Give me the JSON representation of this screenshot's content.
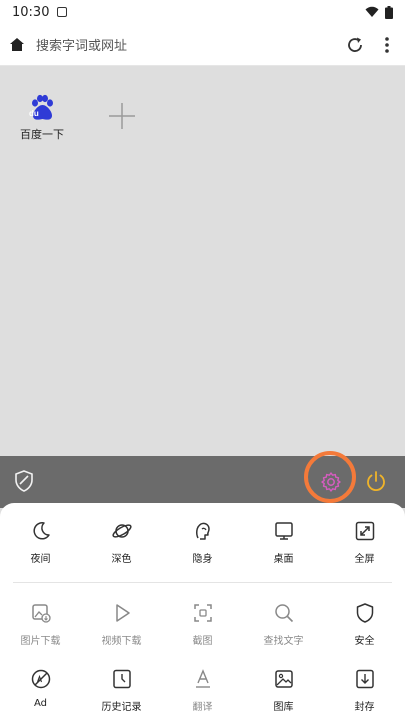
{
  "status": {
    "time": "10:30"
  },
  "toolbar": {
    "search_placeholder": "搜索字词或网址"
  },
  "shortcuts": [
    {
      "label": "百度一下",
      "logo_text": "du"
    }
  ],
  "menu": {
    "row1": [
      {
        "label": "夜间",
        "icon": "moon-icon"
      },
      {
        "label": "深色",
        "icon": "planet-icon"
      },
      {
        "label": "隐身",
        "icon": "incognito-icon"
      },
      {
        "label": "桌面",
        "icon": "desktop-icon"
      },
      {
        "label": "全屏",
        "icon": "fullscreen-icon"
      }
    ],
    "row2": [
      {
        "label": "图片下载",
        "icon": "image-download-icon"
      },
      {
        "label": "视频下载",
        "icon": "video-play-icon"
      },
      {
        "label": "截图",
        "icon": "screenshot-icon"
      },
      {
        "label": "查找文字",
        "icon": "search-icon"
      },
      {
        "label": "安全",
        "icon": "shield-icon"
      }
    ],
    "row3": [
      {
        "label": "Ad",
        "icon": "ad-block-icon"
      },
      {
        "label": "历史记录",
        "icon": "history-icon"
      },
      {
        "label": "翻译",
        "icon": "translate-icon"
      },
      {
        "label": "图库",
        "icon": "gallery-icon"
      },
      {
        "label": "封存",
        "icon": "archive-download-icon"
      }
    ]
  },
  "colors": {
    "accent_gear": "#d65cc0",
    "power": "#f0b429",
    "highlight_circle": "#f47a3a",
    "dark_bar": "#6b6b6b",
    "baidu_blue": "#2f3bd6"
  }
}
